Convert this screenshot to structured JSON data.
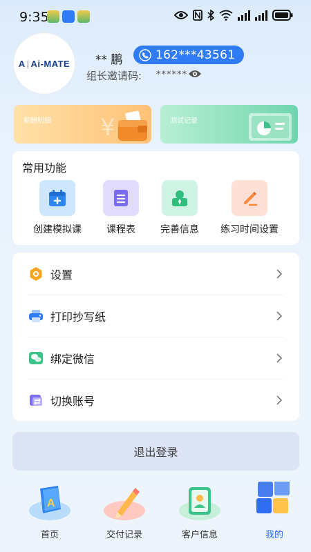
{
  "status_bar": {
    "time": "9:35",
    "icons": [
      "app-notification-icon",
      "app-notification-icon",
      "app-notification-icon",
      "eye-icon",
      "nfc-icon",
      "bluetooth-icon",
      "wifi-icon",
      "signal-icon",
      "signal-icon",
      "battery-icon"
    ]
  },
  "profile": {
    "avatar_logo": "Ai-MATE",
    "avatar_logo_prefix": "A",
    "name": "** 鹏",
    "phone": "162***43561",
    "invite_label": "组长邀请码:",
    "invite_code": "******"
  },
  "banners": {
    "salary_label": "薪酬明细",
    "test_label": "测试记录"
  },
  "common_functions": {
    "title": "常用功能",
    "items": [
      {
        "label": "创建模拟课",
        "icon": "calendar-add-icon"
      },
      {
        "label": "课程表",
        "icon": "schedule-list-icon"
      },
      {
        "label": "完善信息",
        "icon": "user-profile-icon"
      },
      {
        "label": "练习时间设置",
        "icon": "edit-pencil-icon"
      }
    ]
  },
  "menu": {
    "items": [
      {
        "label": "设置",
        "icon": "settings-icon"
      },
      {
        "label": "打印抄写纸",
        "icon": "printer-icon"
      },
      {
        "label": "绑定微信",
        "icon": "wechat-icon"
      },
      {
        "label": "切换账号",
        "icon": "switch-account-icon"
      }
    ]
  },
  "logout_label": "退出登录",
  "tabbar": {
    "items": [
      {
        "label": "首页",
        "icon": "home-book-icon"
      },
      {
        "label": "交付记录",
        "icon": "pencil-record-icon"
      },
      {
        "label": "客户信息",
        "icon": "contacts-icon"
      },
      {
        "label": "我的",
        "icon": "blocks-icon"
      }
    ],
    "active_index": 3
  },
  "colors": {
    "accent": "#2f7cf6",
    "active_tab": "#2f6ef2",
    "logout_bg": "#dce4f5"
  }
}
